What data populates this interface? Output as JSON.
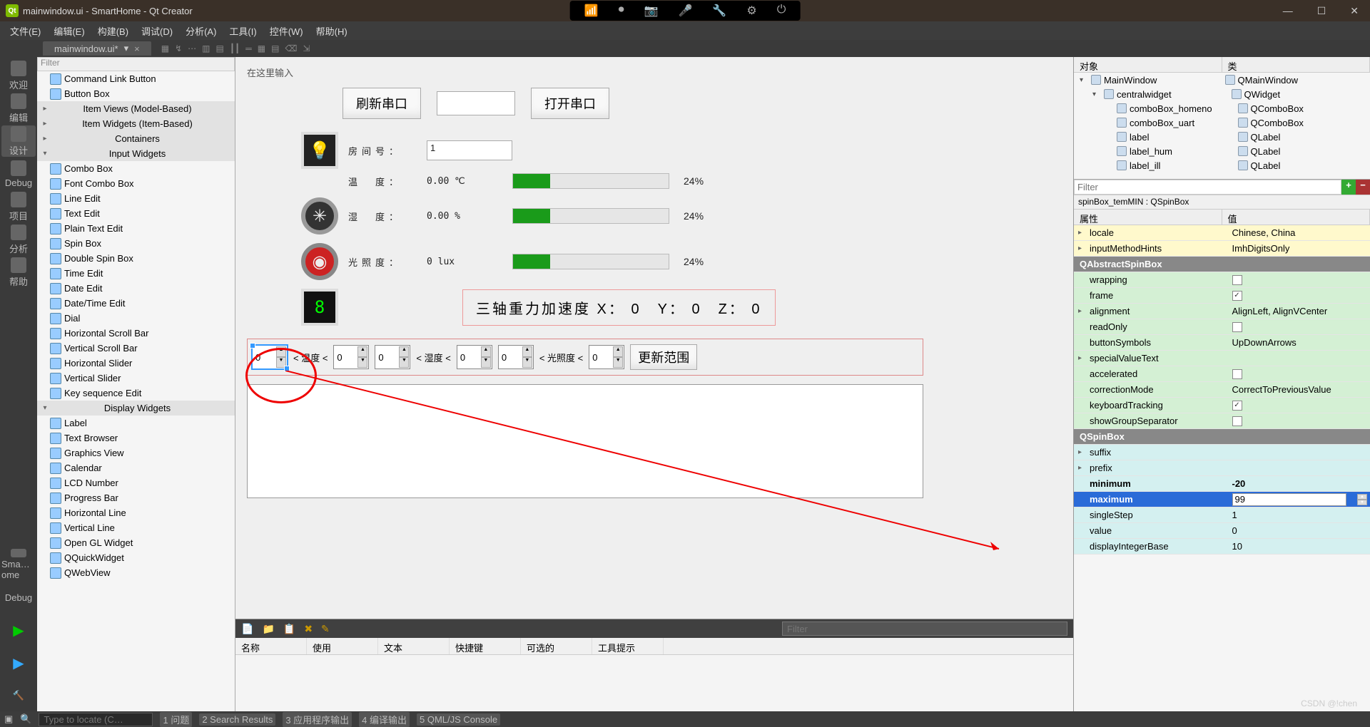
{
  "window": {
    "title": "mainwindow.ui - SmartHome - Qt Creator"
  },
  "menus": [
    "文件(E)",
    "编辑(E)",
    "构建(B)",
    "调试(D)",
    "分析(A)",
    "工具(I)",
    "控件(W)",
    "帮助(H)"
  ],
  "tab": {
    "name": "mainwindow.ui*"
  },
  "leftbar": [
    {
      "label": "欢迎"
    },
    {
      "label": "编辑"
    },
    {
      "label": "设计"
    },
    {
      "label": "Debug"
    },
    {
      "label": "项目"
    },
    {
      "label": "分析"
    },
    {
      "label": "帮助"
    }
  ],
  "leftbar2": [
    {
      "label": "Sma…ome"
    },
    {
      "label": "Debug"
    }
  ],
  "widgetbox": {
    "filter": "Filter",
    "items": [
      {
        "type": "item",
        "label": "Command Link Button"
      },
      {
        "type": "item",
        "label": "Button Box"
      },
      {
        "type": "cat",
        "arrow": ">",
        "label": "Item Views (Model-Based)"
      },
      {
        "type": "cat",
        "arrow": ">",
        "label": "Item Widgets (Item-Based)"
      },
      {
        "type": "cat",
        "arrow": ">",
        "label": "Containers"
      },
      {
        "type": "cat",
        "arrow": "v",
        "label": "Input Widgets"
      },
      {
        "type": "item",
        "label": "Combo Box"
      },
      {
        "type": "item",
        "label": "Font Combo Box"
      },
      {
        "type": "item",
        "label": "Line Edit"
      },
      {
        "type": "item",
        "label": "Text Edit"
      },
      {
        "type": "item",
        "label": "Plain Text Edit"
      },
      {
        "type": "item",
        "label": "Spin Box"
      },
      {
        "type": "item",
        "label": "Double Spin Box"
      },
      {
        "type": "item",
        "label": "Time Edit"
      },
      {
        "type": "item",
        "label": "Date Edit"
      },
      {
        "type": "item",
        "label": "Date/Time Edit"
      },
      {
        "type": "item",
        "label": "Dial"
      },
      {
        "type": "item",
        "label": "Horizontal Scroll Bar"
      },
      {
        "type": "item",
        "label": "Vertical Scroll Bar"
      },
      {
        "type": "item",
        "label": "Horizontal Slider"
      },
      {
        "type": "item",
        "label": "Vertical Slider"
      },
      {
        "type": "item",
        "label": "Key sequence Edit"
      },
      {
        "type": "cat",
        "arrow": "v",
        "label": "Display Widgets"
      },
      {
        "type": "item",
        "label": "Label"
      },
      {
        "type": "item",
        "label": "Text Browser"
      },
      {
        "type": "item",
        "label": "Graphics View"
      },
      {
        "type": "item",
        "label": "Calendar"
      },
      {
        "type": "item",
        "label": "LCD Number"
      },
      {
        "type": "item",
        "label": "Progress Bar"
      },
      {
        "type": "item",
        "label": "Horizontal Line"
      },
      {
        "type": "item",
        "label": "Vertical Line"
      },
      {
        "type": "item",
        "label": "Open GL Widget"
      },
      {
        "type": "item",
        "label": "QQuickWidget"
      },
      {
        "type": "item",
        "label": "QWebView"
      }
    ]
  },
  "form": {
    "hint": "在这里输入",
    "refresh_btn": "刷新串口",
    "open_btn": "打开串口",
    "room_label": "房间号：",
    "room_value": "1",
    "temp_label": "温　度：",
    "temp_value": "0.00 ℃",
    "temp_pct": "24%",
    "hum_label": "湿　度：",
    "hum_value": "0.00 %",
    "hum_pct": "24%",
    "lux_label": "光照度：",
    "lux_value": "0 lux",
    "lux_pct": "24%",
    "accel": "三轴重力加速度 X： 0　Y： 0　Z： 0",
    "range_temp": "< 温度 <",
    "range_hum": "< 湿度 <",
    "range_lux": "< 光照度 <",
    "spin_val": "0",
    "update_btn": "更新范围"
  },
  "actions": {
    "filter": "Filter",
    "headers": [
      "名称",
      "使用",
      "文本",
      "快捷键",
      "可选的",
      "工具提示"
    ]
  },
  "objtree": {
    "h1": "对象",
    "h2": "类",
    "rows": [
      {
        "indent": 0,
        "exp": "v",
        "name": "MainWindow",
        "cls": "QMainWindow"
      },
      {
        "indent": 1,
        "exp": "v",
        "name": "centralwidget",
        "cls": "QWidget"
      },
      {
        "indent": 2,
        "exp": "",
        "name": "comboBox_homeno",
        "cls": "QComboBox"
      },
      {
        "indent": 2,
        "exp": "",
        "name": "comboBox_uart",
        "cls": "QComboBox"
      },
      {
        "indent": 2,
        "exp": "",
        "name": "label",
        "cls": "QLabel"
      },
      {
        "indent": 2,
        "exp": "",
        "name": "label_hum",
        "cls": "QLabel"
      },
      {
        "indent": 2,
        "exp": "",
        "name": "label_ill",
        "cls": "QLabel"
      }
    ]
  },
  "props": {
    "filter": "Filter",
    "path": "spinBox_temMIN : QSpinBox",
    "h1": "属性",
    "h2": "值",
    "rows": [
      {
        "cls": "yellow",
        "exp": ">",
        "k": "locale",
        "v": "Chinese, China"
      },
      {
        "cls": "yellow",
        "exp": ">",
        "k": "inputMethodHints",
        "v": "ImhDigitsOnly"
      },
      {
        "cls": "section",
        "k": "QAbstractSpinBox",
        "v": ""
      },
      {
        "cls": "green",
        "k": "wrapping",
        "v": "",
        "check": false
      },
      {
        "cls": "green",
        "k": "frame",
        "v": "",
        "check": true
      },
      {
        "cls": "green",
        "exp": ">",
        "k": "alignment",
        "v": "AlignLeft, AlignVCenter"
      },
      {
        "cls": "green",
        "k": "readOnly",
        "v": "",
        "check": false
      },
      {
        "cls": "green",
        "k": "buttonSymbols",
        "v": "UpDownArrows"
      },
      {
        "cls": "green",
        "exp": ">",
        "k": "specialValueText",
        "v": ""
      },
      {
        "cls": "green",
        "k": "accelerated",
        "v": "",
        "check": false
      },
      {
        "cls": "green",
        "k": "correctionMode",
        "v": "CorrectToPreviousValue"
      },
      {
        "cls": "green",
        "k": "keyboardTracking",
        "v": "",
        "check": true
      },
      {
        "cls": "green",
        "k": "showGroupSeparator",
        "v": "",
        "check": false
      },
      {
        "cls": "section",
        "k": "QSpinBox",
        "v": ""
      },
      {
        "cls": "cyan",
        "exp": ">",
        "k": "suffix",
        "v": ""
      },
      {
        "cls": "cyan",
        "exp": ">",
        "k": "prefix",
        "v": ""
      },
      {
        "cls": "cyan bold",
        "k": "minimum",
        "v": "-20"
      },
      {
        "cls": "sel bold",
        "k": "maximum",
        "v": "99",
        "editable": true
      },
      {
        "cls": "cyan",
        "k": "singleStep",
        "v": "1"
      },
      {
        "cls": "cyan",
        "k": "value",
        "v": "0"
      },
      {
        "cls": "cyan",
        "k": "displayIntegerBase",
        "v": "10"
      }
    ]
  },
  "status": {
    "locator": "Type to locate (C…",
    "tabs": [
      "1 问题",
      "2 Search Results",
      "3 应用程序输出",
      "4 编译输出",
      "5 QML/JS Console"
    ]
  },
  "watermark": "CSDN @!chen"
}
